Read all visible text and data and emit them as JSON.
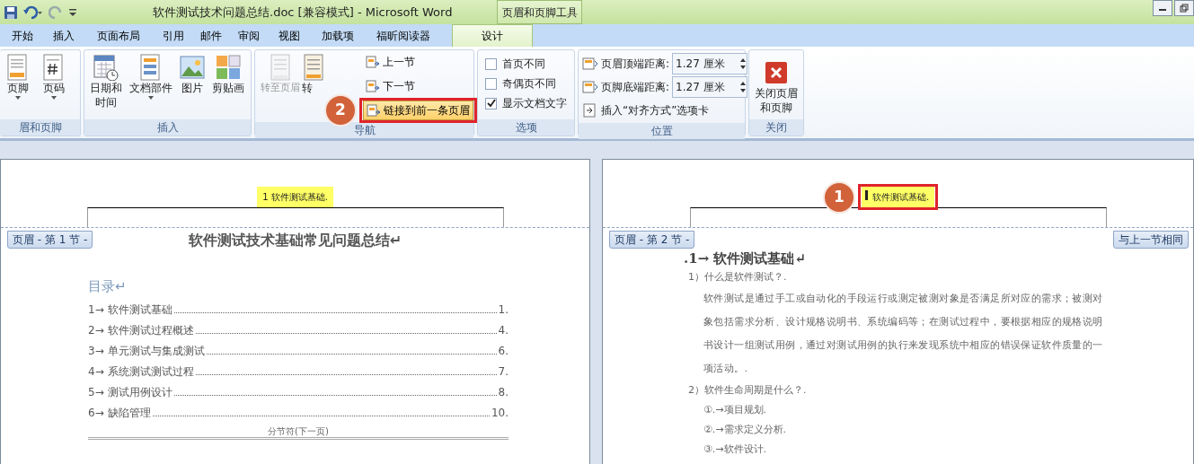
{
  "window": {
    "title": "软件测试技术问题总结.doc [兼容模式] - Microsoft Word",
    "context_tab": "页眉和页脚工具"
  },
  "tabs": [
    {
      "label": "开始",
      "selected": false
    },
    {
      "label": "插入",
      "selected": false
    },
    {
      "label": "页面布局",
      "selected": false
    },
    {
      "label": "引用",
      "selected": false
    },
    {
      "label": "邮件",
      "selected": false
    },
    {
      "label": "审阅",
      "selected": false
    },
    {
      "label": "视图",
      "selected": false
    },
    {
      "label": "加载项",
      "selected": false
    },
    {
      "label": "福昕阅读器",
      "selected": false
    },
    {
      "label": "设计",
      "selected": true
    }
  ],
  "ribbon": {
    "groups": [
      {
        "label": "眉和页脚",
        "kind": "large",
        "buttons": [
          {
            "label": "页脚",
            "dropdown": true
          },
          {
            "label": "页码",
            "dropdown": true
          }
        ]
      },
      {
        "label": "插入",
        "kind": "large",
        "buttons": [
          {
            "label": "日期和时间",
            "dropdown": false
          },
          {
            "label": "文档部件",
            "dropdown": true
          },
          {
            "label": "图片",
            "dropdown": false
          },
          {
            "label": "剪贴画",
            "dropdown": false
          }
        ]
      },
      {
        "label": "导航",
        "kind": "nav",
        "buttons": [
          {
            "label": "转至页眉",
            "disabled": true
          },
          {
            "label": "转",
            "disabled": false
          }
        ],
        "small": [
          {
            "label": "上一节",
            "selected": false
          },
          {
            "label": "下一节",
            "selected": false
          },
          {
            "label": "链接到前一条页眉",
            "selected": true
          }
        ]
      },
      {
        "label": "选项",
        "kind": "checks",
        "checks": [
          {
            "label": "首页不同",
            "checked": false
          },
          {
            "label": "奇偶页不同",
            "checked": false
          },
          {
            "label": "显示文档文字",
            "checked": true
          }
        ]
      },
      {
        "label": "位置",
        "kind": "position",
        "spins": [
          {
            "label": "页眉顶端距离:",
            "value": "1.27 厘米"
          },
          {
            "label": "页脚底端距离:",
            "value": "1.27 厘米"
          }
        ],
        "link": "插入“对齐方式”选项卡"
      },
      {
        "label": "关闭",
        "kind": "close",
        "button": "关闭页眉和页脚"
      }
    ]
  },
  "pages": [
    {
      "header_text": "1 软件测试基础.",
      "section_tag": "页眉 - 第 1 节 -",
      "title": "软件测试技术基础常见问题总结↵",
      "toc_heading": "目录↵",
      "toc": [
        {
          "num": "1→",
          "text": "软件测试基础",
          "page": "1."
        },
        {
          "num": "2→",
          "text": "软件测试过程概述",
          "page": "4."
        },
        {
          "num": "3→",
          "text": "单元测试与集成测试",
          "page": "6."
        },
        {
          "num": "4→",
          "text": "系统测试测试过程",
          "page": "7."
        },
        {
          "num": "5→",
          "text": "测试用例设计",
          "page": "8."
        },
        {
          "num": "6→",
          "text": "缺陷管理",
          "page": "10."
        }
      ],
      "section_break": "分节符(下一页)"
    },
    {
      "header_text": "软件测试基础.",
      "section_tag": "页眉 - 第 2 节 -",
      "same_as_previous": "与上一节相同",
      "heading": ".1→ 软件测试基础↵",
      "blocks": [
        {
          "kind": "question",
          "text": "1）什么是软件测试？."
        },
        {
          "kind": "para",
          "text": "软件测试是通过手工或自动化的手段运行或测定被测对象是否满足所对应的需求；被测对象包括需求分析、设计规格说明书、系统编码等；在测试过程中，要根据相应的规格说明书设计一组测试用例，通过对测试用例的执行来发现系统中相应的错误保证软件质量的一项活动。."
        },
        {
          "kind": "question",
          "text": "2）软件生命周期是什么？."
        },
        {
          "kind": "step",
          "text": "①.→项目规划."
        },
        {
          "kind": "step",
          "text": "②.→需求定义分析."
        },
        {
          "kind": "step",
          "text": "③.→软件设计."
        }
      ]
    }
  ],
  "annotations": [
    {
      "label": "2"
    },
    {
      "label": "1"
    }
  ]
}
